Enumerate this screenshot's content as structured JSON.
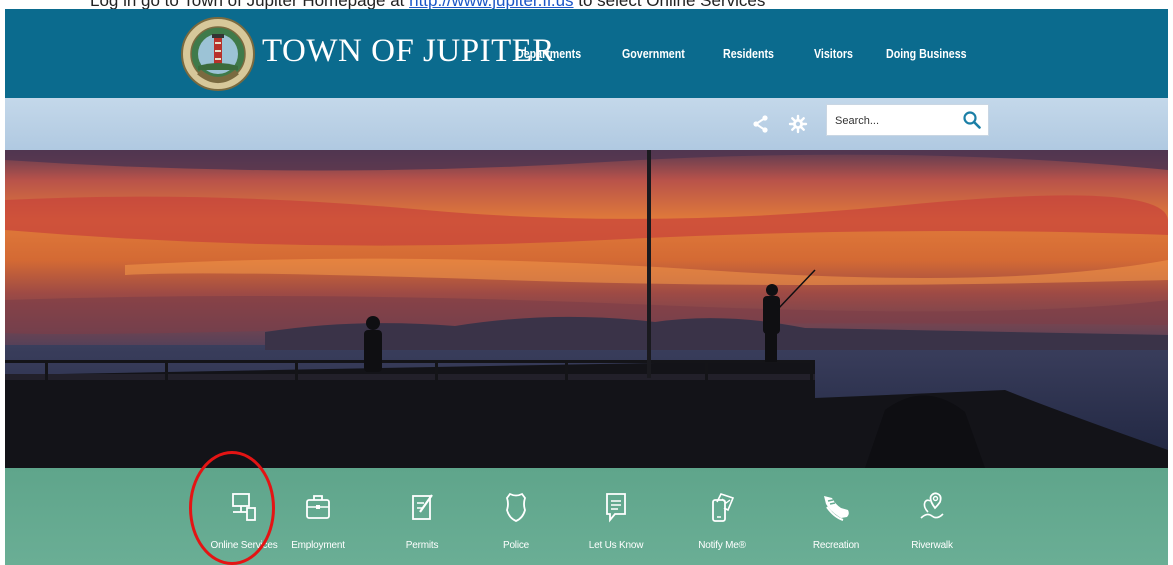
{
  "doc": {
    "text_before": "Log in go to Town of Jupiter Homepage at ",
    "link_text": "http://www.jupiter.fl.us",
    "text_after": " to select Online Services"
  },
  "header": {
    "town_name": "TOWN OF JUPITER",
    "nav": [
      "Departments",
      "Government",
      "Residents",
      "Visitors",
      "Doing Business"
    ]
  },
  "utility": {
    "search_placeholder": "Search..."
  },
  "services": [
    {
      "label": "Online Services",
      "icon": "online-services-icon"
    },
    {
      "label": "Employment",
      "icon": "briefcase-icon"
    },
    {
      "label": "Permits",
      "icon": "permits-icon"
    },
    {
      "label": "Police",
      "icon": "police-badge-icon"
    },
    {
      "label": "Let Us Know",
      "icon": "comment-icon"
    },
    {
      "label": "Notify Me®",
      "icon": "notify-phone-icon"
    },
    {
      "label": "Recreation",
      "icon": "sneaker-icon"
    },
    {
      "label": "Riverwalk",
      "icon": "map-pin-icon"
    }
  ],
  "colors": {
    "header_bg": "#0b6b8e",
    "utility_bar": "#b6cde3",
    "services_bg": "#65ab92",
    "annotation": "#e41414"
  }
}
